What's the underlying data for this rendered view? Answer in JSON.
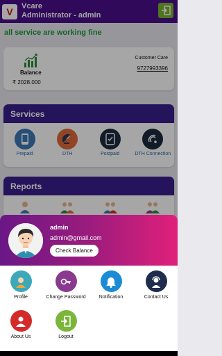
{
  "app": {
    "title": "Vcare",
    "subtitle": "Administrator - admin",
    "logo_letter": "V"
  },
  "status_text": "all service are working fine",
  "balance": {
    "label": "Balance",
    "value": "₹ 2028.000",
    "customer_care_label": "Customer Care",
    "customer_care_number": "9727993396"
  },
  "services": {
    "title": "Services",
    "items": [
      {
        "label": "Prepaid",
        "icon": "mobile-phone-icon",
        "color": "#3b78b5"
      },
      {
        "label": "DTH",
        "icon": "satellite-dish-icon",
        "color": "#e06a3b"
      },
      {
        "label": "Postpaid",
        "icon": "bill-phone-icon",
        "color": "#1d2a3e"
      },
      {
        "label": "DTH Connection",
        "icon": "satellite-antenna-icon",
        "color": "#1d2a3e"
      }
    ]
  },
  "reports": {
    "title": "Reports"
  },
  "profile": {
    "name": "admin",
    "email": "admin@gmail.com",
    "check_balance_label": "Check Balance"
  },
  "menu": [
    {
      "label": "Profile",
      "icon": "profile-icon",
      "color": "#3ca8b8"
    },
    {
      "label": "Change Password",
      "icon": "key-icon",
      "color": "#8a3a8e"
    },
    {
      "label": "Notification",
      "icon": "bell-icon",
      "color": "#1c8bd6"
    },
    {
      "label": "Contact Us",
      "icon": "support-agent-icon",
      "color": "#1e2d4b"
    },
    {
      "label": "About Us",
      "icon": "about-user-icon",
      "color": "#d42a2a"
    },
    {
      "label": "Logout",
      "icon": "logout-icon",
      "color": "#7bb53a"
    }
  ],
  "colors": {
    "topbar": "#4a0f8c",
    "section_header": "#3a1e8c",
    "status_green": "#1d9a3c",
    "band_start": "#6a1786",
    "band_end": "#e0207a"
  }
}
